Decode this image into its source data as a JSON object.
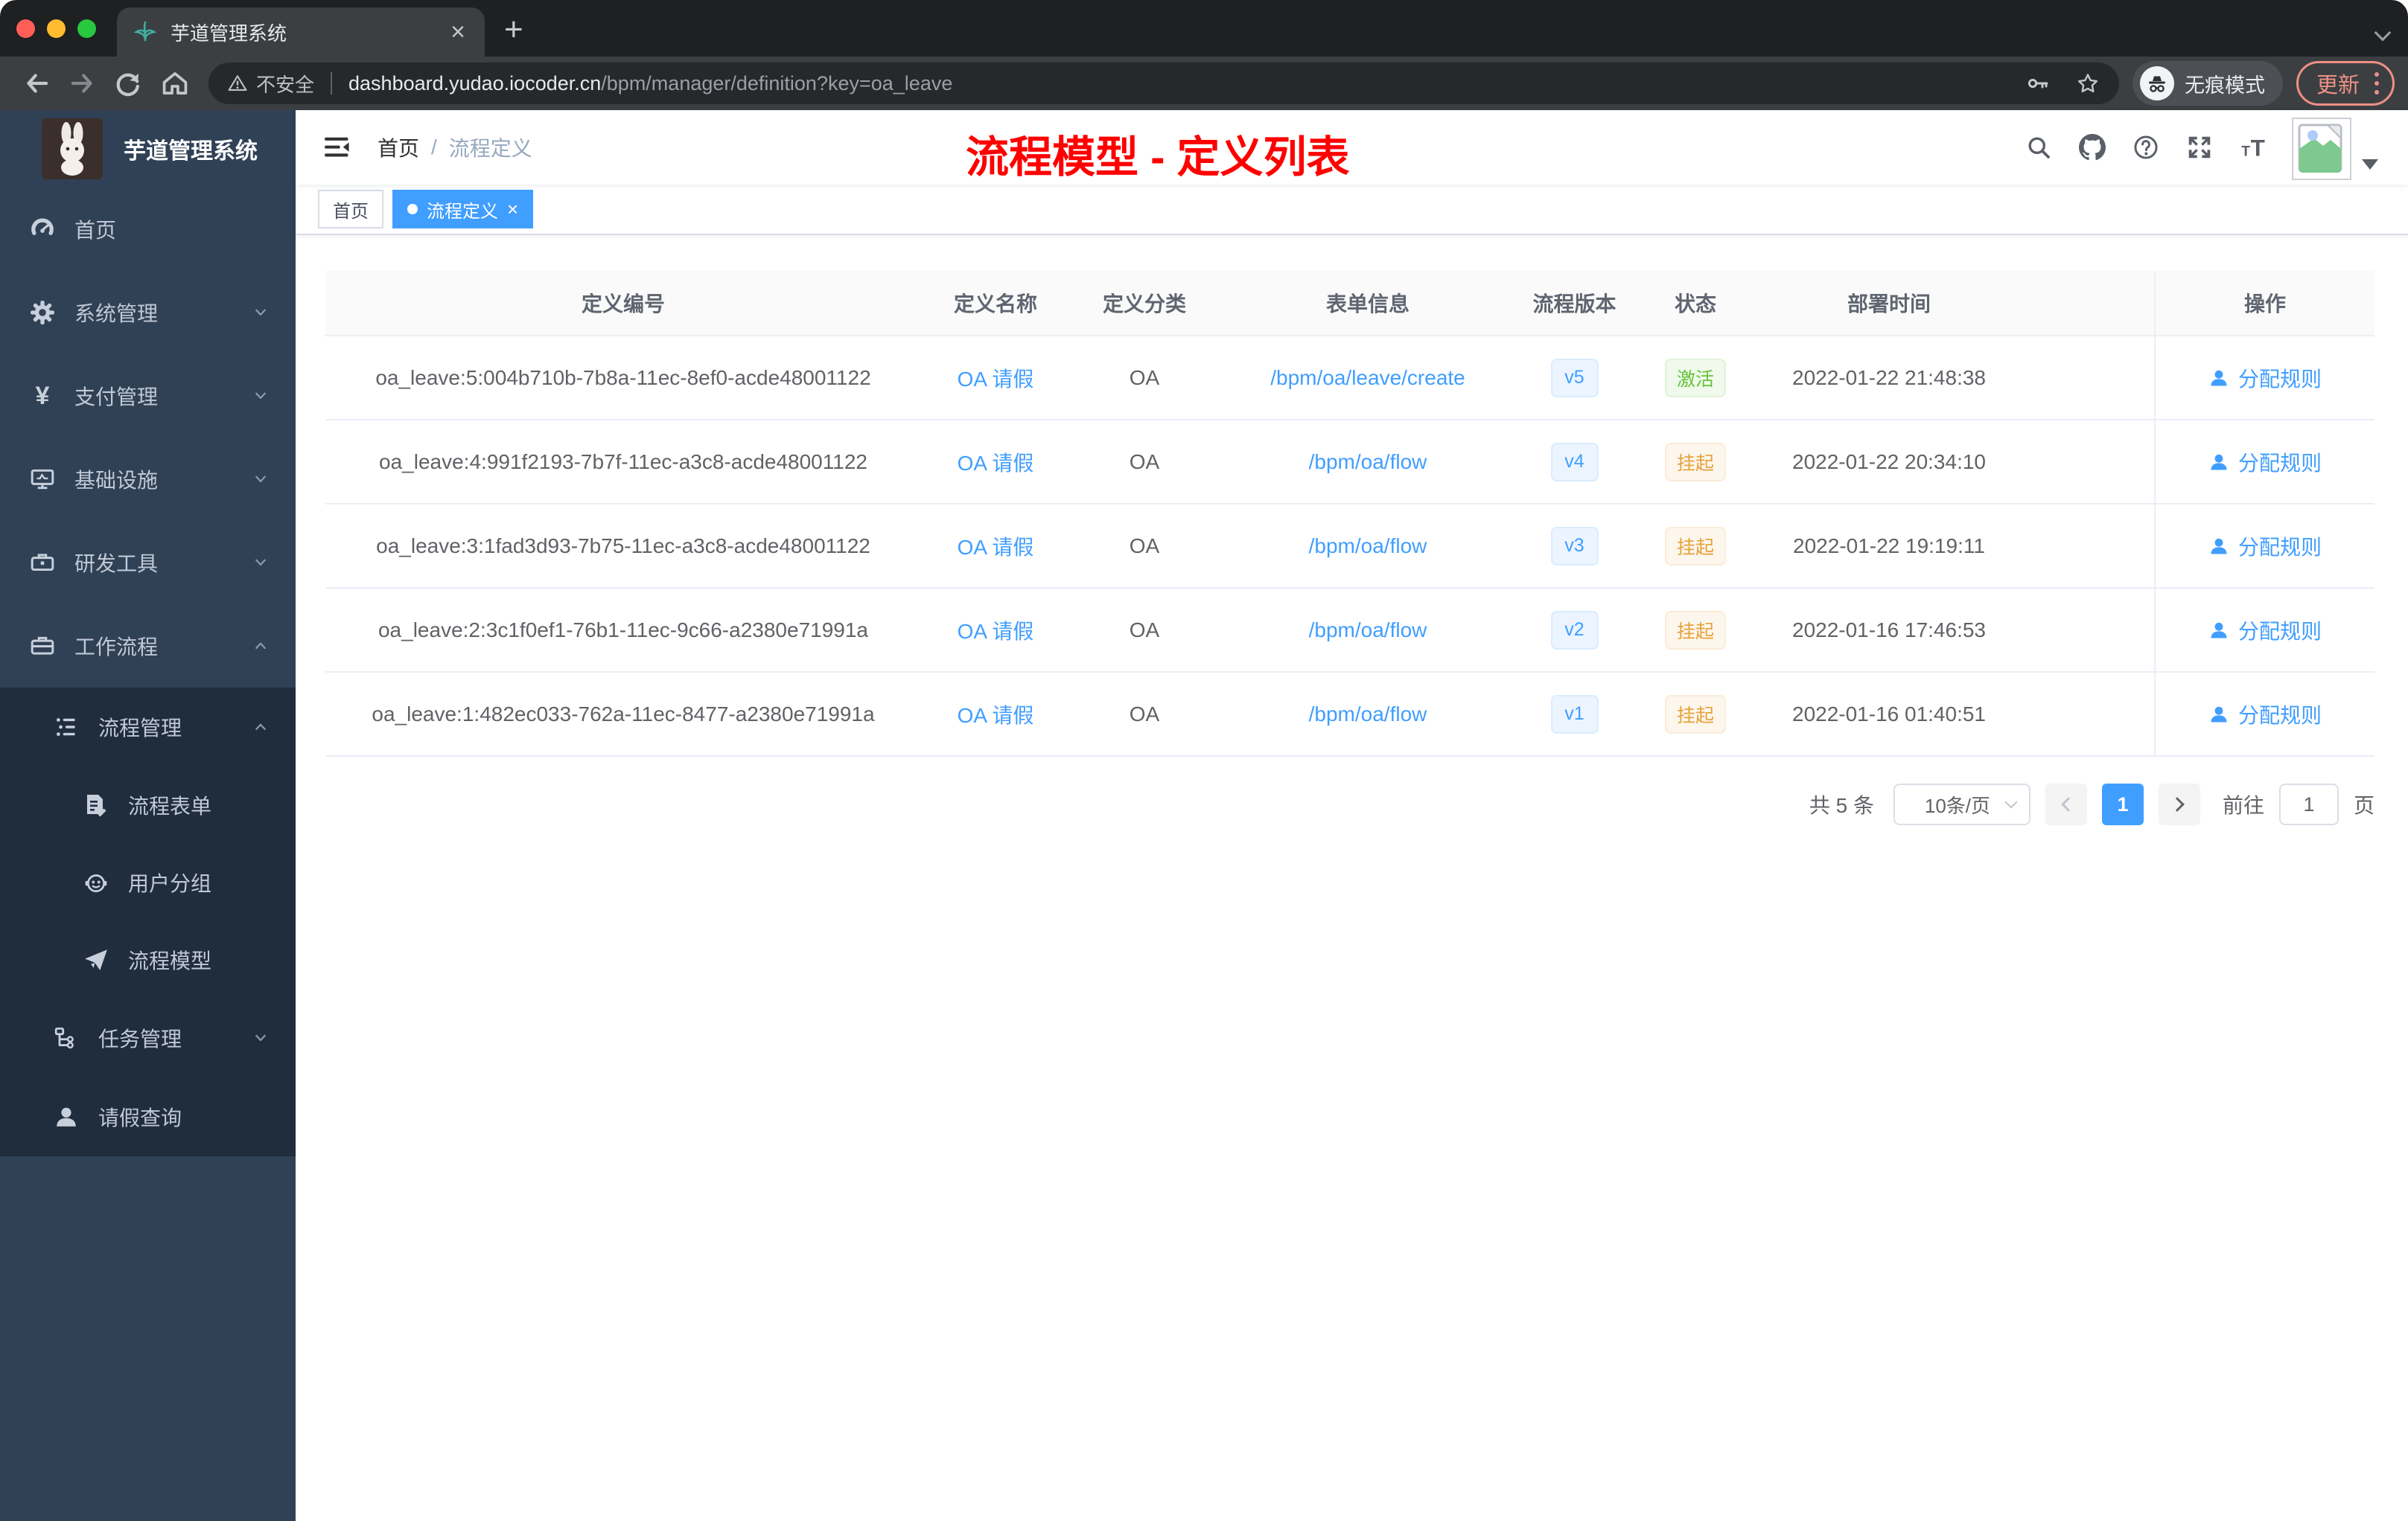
{
  "browser": {
    "tab": {
      "title": "芋道管理系统"
    },
    "url": {
      "security": "不安全",
      "host": "dashboard.yudao.iocoder.cn",
      "path": "/bpm/manager/definition?key=oa_leave"
    },
    "incognito_label": "无痕模式",
    "update_label": "更新"
  },
  "sidebar": {
    "title": "芋道管理系统",
    "items": [
      {
        "label": "首页",
        "icon": "dashboard-icon"
      },
      {
        "label": "系统管理",
        "icon": "gear-icon"
      },
      {
        "label": "支付管理",
        "icon": "yen-icon"
      },
      {
        "label": "基础设施",
        "icon": "monitor-icon"
      },
      {
        "label": "研发工具",
        "icon": "toolbox-icon"
      },
      {
        "label": "工作流程",
        "icon": "briefcase-icon"
      },
      {
        "label": "流程管理",
        "icon": "list-icon"
      },
      {
        "label": "流程表单",
        "icon": "form-doc-icon"
      },
      {
        "label": "用户分组",
        "icon": "robot-icon"
      },
      {
        "label": "流程模型",
        "icon": "paper-plane-icon"
      },
      {
        "label": "任务管理",
        "icon": "tree-icon"
      },
      {
        "label": "请假查询",
        "icon": "person-icon"
      }
    ]
  },
  "header": {
    "breadcrumb": {
      "home": "首页",
      "sep": "/",
      "current": "流程定义"
    },
    "annotation": "流程模型 - 定义列表"
  },
  "tags": {
    "home": "首页",
    "active": "流程定义",
    "close": "×"
  },
  "table": {
    "columns": [
      "定义编号",
      "定义名称",
      "定义分类",
      "表单信息",
      "流程版本",
      "状态",
      "部署时间",
      "操作"
    ],
    "rows": [
      {
        "id": "oa_leave:5:004b710b-7b8a-11ec-8ef0-acde48001122",
        "name": "OA 请假",
        "category": "OA",
        "form": "/bpm/oa/leave/create",
        "version": "v5",
        "status": "激活",
        "time": "2022-01-22 21:48:38",
        "action": "分配规则"
      },
      {
        "id": "oa_leave:4:991f2193-7b7f-11ec-a3c8-acde48001122",
        "name": "OA 请假",
        "category": "OA",
        "form": "/bpm/oa/flow",
        "version": "v4",
        "status": "挂起",
        "time": "2022-01-22 20:34:10",
        "action": "分配规则"
      },
      {
        "id": "oa_leave:3:1fad3d93-7b75-11ec-a3c8-acde48001122",
        "name": "OA 请假",
        "category": "OA",
        "form": "/bpm/oa/flow",
        "version": "v3",
        "status": "挂起",
        "time": "2022-01-22 19:19:11",
        "action": "分配规则"
      },
      {
        "id": "oa_leave:2:3c1f0ef1-76b1-11ec-9c66-a2380e71991a",
        "name": "OA 请假",
        "category": "OA",
        "form": "/bpm/oa/flow",
        "version": "v2",
        "status": "挂起",
        "time": "2022-01-16 17:46:53",
        "action": "分配规则"
      },
      {
        "id": "oa_leave:1:482ec033-762a-11ec-8477-a2380e71991a",
        "name": "OA 请假",
        "category": "OA",
        "form": "/bpm/oa/flow",
        "version": "v1",
        "status": "挂起",
        "time": "2022-01-16 01:40:51",
        "action": "分配规则"
      }
    ]
  },
  "pagination": {
    "total": "共 5 条",
    "page_size": "10条/页",
    "current_page": "1",
    "goto_label": "前往",
    "goto_value": "1",
    "page_unit": "页"
  },
  "colors": {
    "accent": "#409eff",
    "success": "#67c23a",
    "warning": "#e6a23c",
    "annotation": "#fe0000",
    "sidebar_bg": "#304156",
    "submenu_bg": "#1f2d3d"
  }
}
